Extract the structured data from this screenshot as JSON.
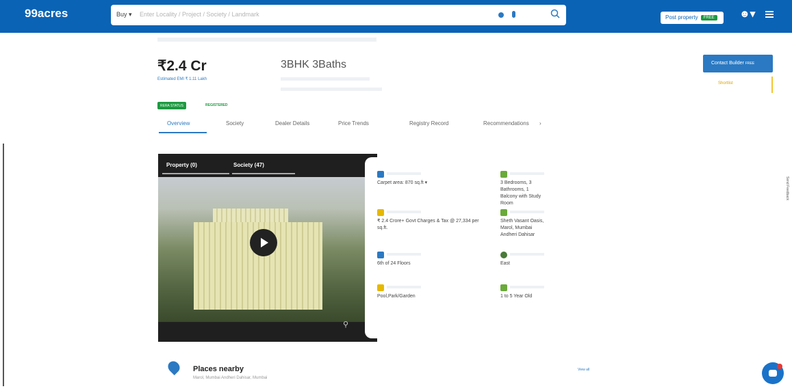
{
  "brand": {
    "logo": "99acres",
    "primary_color": "#0b63b5",
    "accent_color": "#2b79c2"
  },
  "search": {
    "buy_label": "Buy ▾",
    "placeholder": "Enter Locality / Project / Society / Landmark"
  },
  "header_actions": {
    "post_property": "Post property",
    "free_badge": "FREE",
    "user_icon": "user-icon",
    "menu_icon": "menu-icon"
  },
  "listing": {
    "price": "₹2.4 Cr",
    "emi": "Estimated EMI ₹ 1.11 Lakh",
    "config": "3BHK 3Baths",
    "contact_label": "Contact Builder",
    "contact_badge": "FREE",
    "shortlist": "Shortlist",
    "verified": "RERA STATUS",
    "rera": "REGISTERED"
  },
  "tabs": [
    {
      "label": "Overview",
      "active": true
    },
    {
      "label": "Society",
      "active": false
    },
    {
      "label": "Dealer Details",
      "active": false
    },
    {
      "label": "Price Trends",
      "active": false
    },
    {
      "label": "Registry Record",
      "active": false
    },
    {
      "label": "Recommendations",
      "active": false
    }
  ],
  "tabs_more": "›",
  "media": {
    "tab_property": "Property (0)",
    "tab_society": "Society (47)"
  },
  "details": [
    {
      "icon": "area-icon",
      "color": "#2b79c2",
      "value": "Carpet area: 870 sq.ft ▾"
    },
    {
      "icon": "config-icon",
      "color": "#6aaa3a",
      "value": "3 Bedrooms, 3 Bathrooms, 1 Balcony with Study Room"
    },
    {
      "icon": "price-icon",
      "color": "#e6b800",
      "value": "₹ 2.4 Crore+ Govt Charges & Tax @ 27,334 per sq.ft."
    },
    {
      "icon": "address-icon",
      "color": "#6aaa3a",
      "value": "Sheth Vasant Oasis, Marol, Mumbai Andheri Dahisar"
    },
    {
      "icon": "floor-icon",
      "color": "#2b79c2",
      "value": "6th of 24 Floors"
    },
    {
      "icon": "facing-icon",
      "color": "#4a7a3a",
      "value": "East"
    },
    {
      "icon": "overlooking-icon",
      "color": "#e6b800",
      "value": "Pool,Park/Garden"
    },
    {
      "icon": "age-icon",
      "color": "#6aaa3a",
      "value": "1 to 5 Year Old"
    }
  ],
  "feedback": "Send Feedback",
  "places": {
    "title": "Places nearby",
    "subtitle": "Marol, Mumbai Andheri Dahisar, Mumbai",
    "view_all": "View all"
  }
}
